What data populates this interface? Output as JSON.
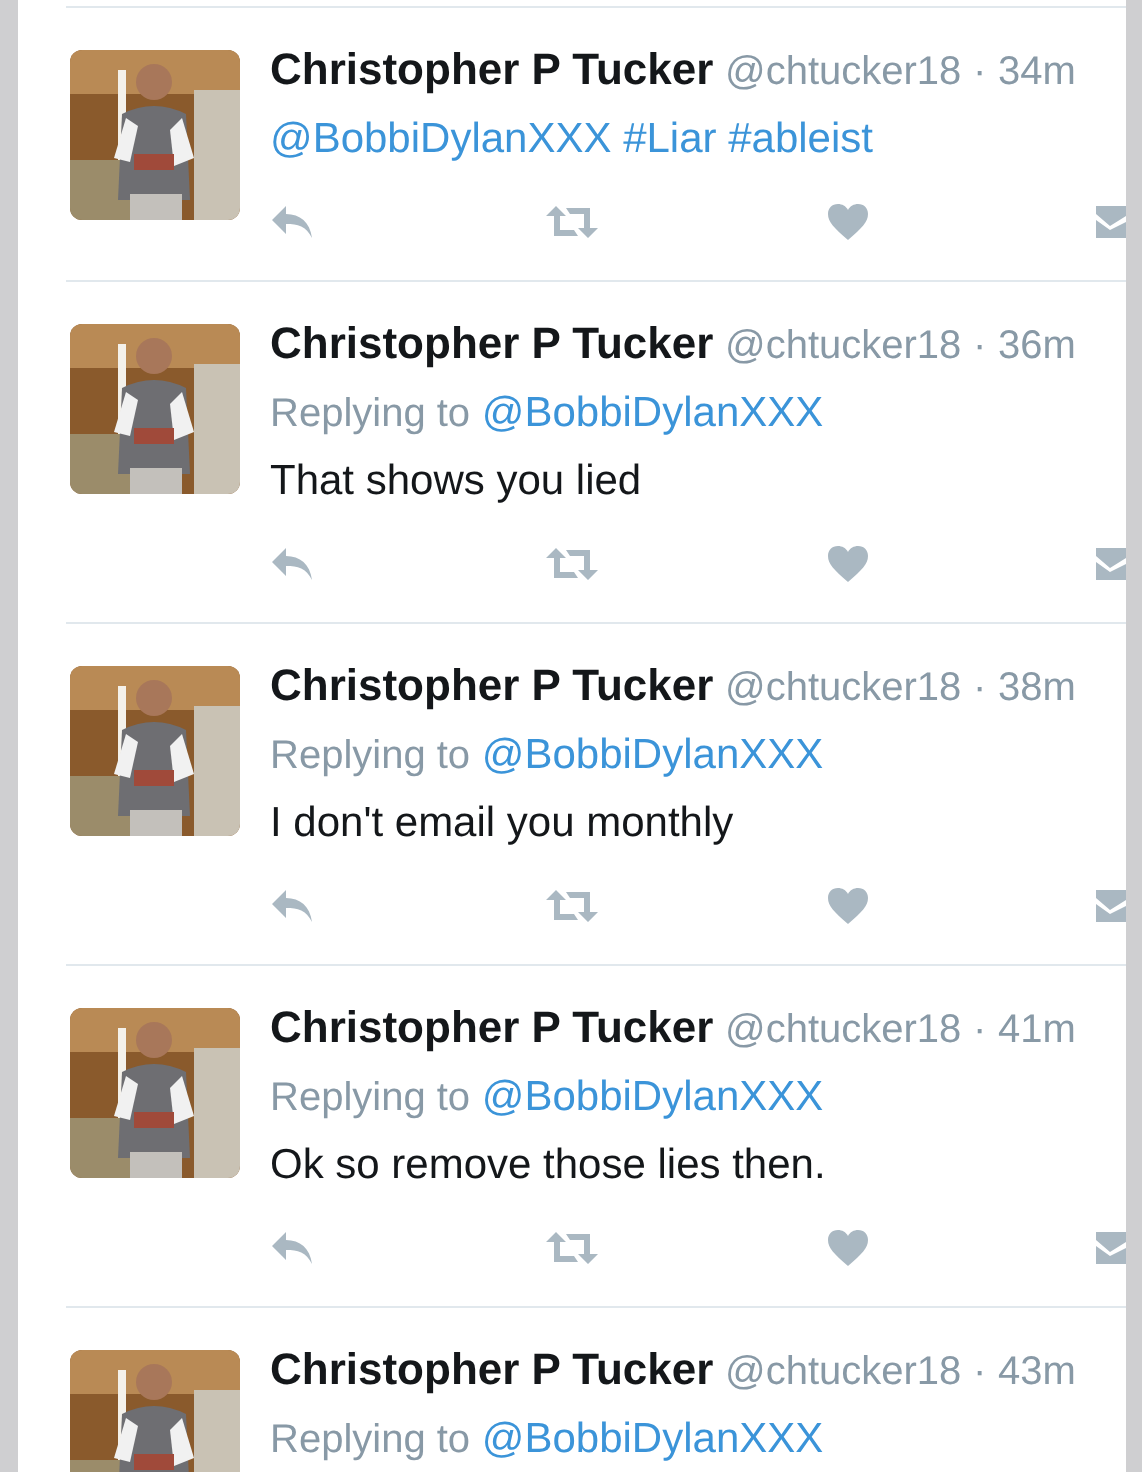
{
  "tweets": [
    {
      "name": "Christopher P Tucker",
      "handle": "@chtucker18",
      "separator": "·",
      "time": "34m",
      "body": {
        "kind": "links",
        "text": "@BobbiDylanXXX #Liar #ableist"
      }
    },
    {
      "name": "Christopher P Tucker",
      "handle": "@chtucker18",
      "separator": "·",
      "time": "36m",
      "replying_label": "Replying to",
      "replying_to": "@BobbiDylanXXX",
      "body": {
        "kind": "plain",
        "text": "That shows you lied"
      }
    },
    {
      "name": "Christopher P Tucker",
      "handle": "@chtucker18",
      "separator": "·",
      "time": "38m",
      "replying_label": "Replying to",
      "replying_to": "@BobbiDylanXXX",
      "body": {
        "kind": "plain",
        "text": "I don't email you monthly"
      }
    },
    {
      "name": "Christopher P Tucker",
      "handle": "@chtucker18",
      "separator": "·",
      "time": "41m",
      "replying_label": "Replying to",
      "replying_to": "@BobbiDylanXXX",
      "body": {
        "kind": "plain",
        "text": "Ok so remove those lies then."
      }
    },
    {
      "name": "Christopher P Tucker",
      "handle": "@chtucker18",
      "separator": "·",
      "time": "43m",
      "replying_label": "Replying to",
      "replying_to": "@BobbiDylanXXX"
    }
  ]
}
